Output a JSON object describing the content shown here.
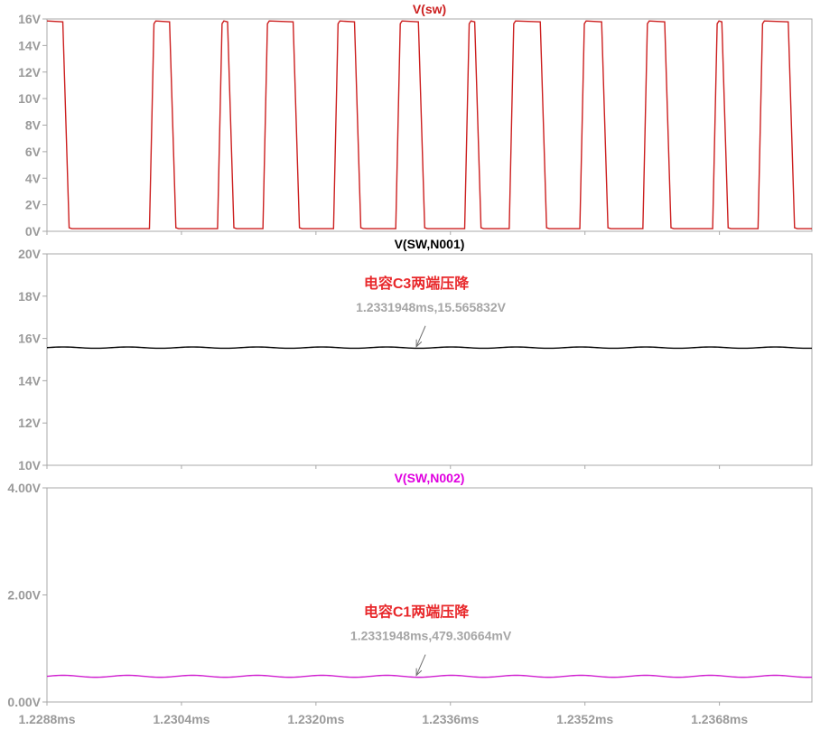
{
  "chart_data": [
    {
      "type": "line",
      "title": "V(sw)",
      "title_color": "#cc1f1f",
      "series": [
        {
          "name": "V(sw)",
          "color": "#cc1f1f"
        }
      ],
      "ylim": [
        0,
        16
      ],
      "y_ticks": [
        0,
        2,
        4,
        6,
        8,
        10,
        12,
        14,
        16
      ],
      "y_tick_labels": [
        "0V",
        "2V",
        "4V",
        "6V",
        "8V",
        "10V",
        "12V",
        "14V",
        "16V"
      ],
      "waveform": {
        "kind": "square",
        "high": 15.85,
        "low": 0.2,
        "rising_edges_ms": [
          1.23003,
          1.23084,
          1.23138,
          1.23222,
          1.23296,
          1.23378,
          1.23431,
          1.23515,
          1.2359,
          1.23673,
          1.23727
        ],
        "falling_edges_ms": [
          1.22901,
          1.23028,
          1.23097,
          1.23175,
          1.23248,
          1.23324,
          1.23391,
          1.23469,
          1.23542,
          1.23617,
          1.23685,
          1.23764
        ]
      },
      "grid": false
    },
    {
      "type": "line",
      "title": "V(SW,N001)",
      "title_color": "#000000",
      "series": [
        {
          "name": "V(SW,N001)",
          "color": "#000000",
          "mean": 15.565832,
          "ripple": 0.03
        }
      ],
      "ylim": [
        10,
        20
      ],
      "y_ticks": [
        10,
        12,
        14,
        16,
        18,
        20
      ],
      "y_tick_labels": [
        "10V",
        "12V",
        "14V",
        "16V",
        "18V",
        "20V"
      ],
      "annotation": "电容C3两端压降",
      "cursor": {
        "label": "1.2331948ms,15.565832V",
        "x": 1.2331948,
        "y": 15.565832
      },
      "grid": false
    },
    {
      "type": "line",
      "title": "V(SW,N002)",
      "title_color": "#e000e0",
      "series": [
        {
          "name": "V(SW,N002)",
          "color": "#d020d0",
          "mean": 0.48,
          "ripple": 0.018
        }
      ],
      "ylim": [
        0,
        4
      ],
      "y_ticks": [
        0,
        2,
        4
      ],
      "y_tick_labels": [
        "0.00V",
        "2.00V",
        "4.00V"
      ],
      "annotation": "电容C1两端压降",
      "cursor": {
        "label": "1.2331948ms,479.30664mV",
        "x": 1.2331948,
        "y": 0.47930664
      },
      "grid": false
    }
  ],
  "x_axis": {
    "xlim": [
      1.2288,
      1.2379
    ],
    "ticks": [
      1.2288,
      1.2304,
      1.232,
      1.2336,
      1.2352,
      1.2368
    ],
    "tick_labels": [
      "1.2288ms",
      "1.2304ms",
      "1.2320ms",
      "1.2336ms",
      "1.2352ms",
      "1.2368ms"
    ]
  },
  "colors": {
    "frame": "#a8a8a8",
    "tick_text": "#9a9a9a",
    "annotation": "#e8282b",
    "cursor_text": "#a6a6a6",
    "cursor_arrow": "#707070"
  }
}
